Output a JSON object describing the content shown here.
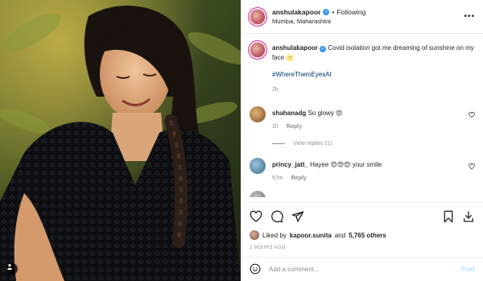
{
  "post": {
    "author": {
      "username": "anshulakapoor",
      "verified": true
    },
    "header": {
      "separator": "•",
      "follow_label": "Following",
      "location": "Mumbai, Maharashtra"
    },
    "caption": {
      "username": "anshulakapoor",
      "text": "Covid isolation got me dreaming of sunshine on my face 🌝",
      "hashtag": "#WhereThemEyesAt",
      "age": "2h"
    },
    "comments": [
      {
        "username": "shahanadg",
        "text": "So glowy 😍",
        "age": "1h",
        "reply_label": "Reply",
        "avatar_color": "#a77a43"
      },
      {
        "username": "princy_jatt_",
        "text": "Hayee 😍😍😍 your smile",
        "age": "57m",
        "reply_label": "Reply",
        "avatar_color": "#5b8fae"
      }
    ],
    "view_replies_label": "View replies (1)",
    "likes": {
      "prefix": "Liked by",
      "user": "kapoor.sunita",
      "middle": "and",
      "others": "5,765 others"
    },
    "timestamp": "2 HOURS AGO",
    "add_comment": {
      "placeholder": "Add a comment...",
      "post_label": "Post"
    },
    "icons": {
      "more": "more-horizontal-icon",
      "like": "heart-icon",
      "comment": "comment-icon",
      "share": "paper-plane-icon",
      "save": "bookmark-icon",
      "emoji": "emoji-icon"
    },
    "colors": {
      "link": "#00376b",
      "verified": "#3897f0",
      "muted": "#8e8e8e",
      "post_disabled": "#b2dffc"
    }
  }
}
